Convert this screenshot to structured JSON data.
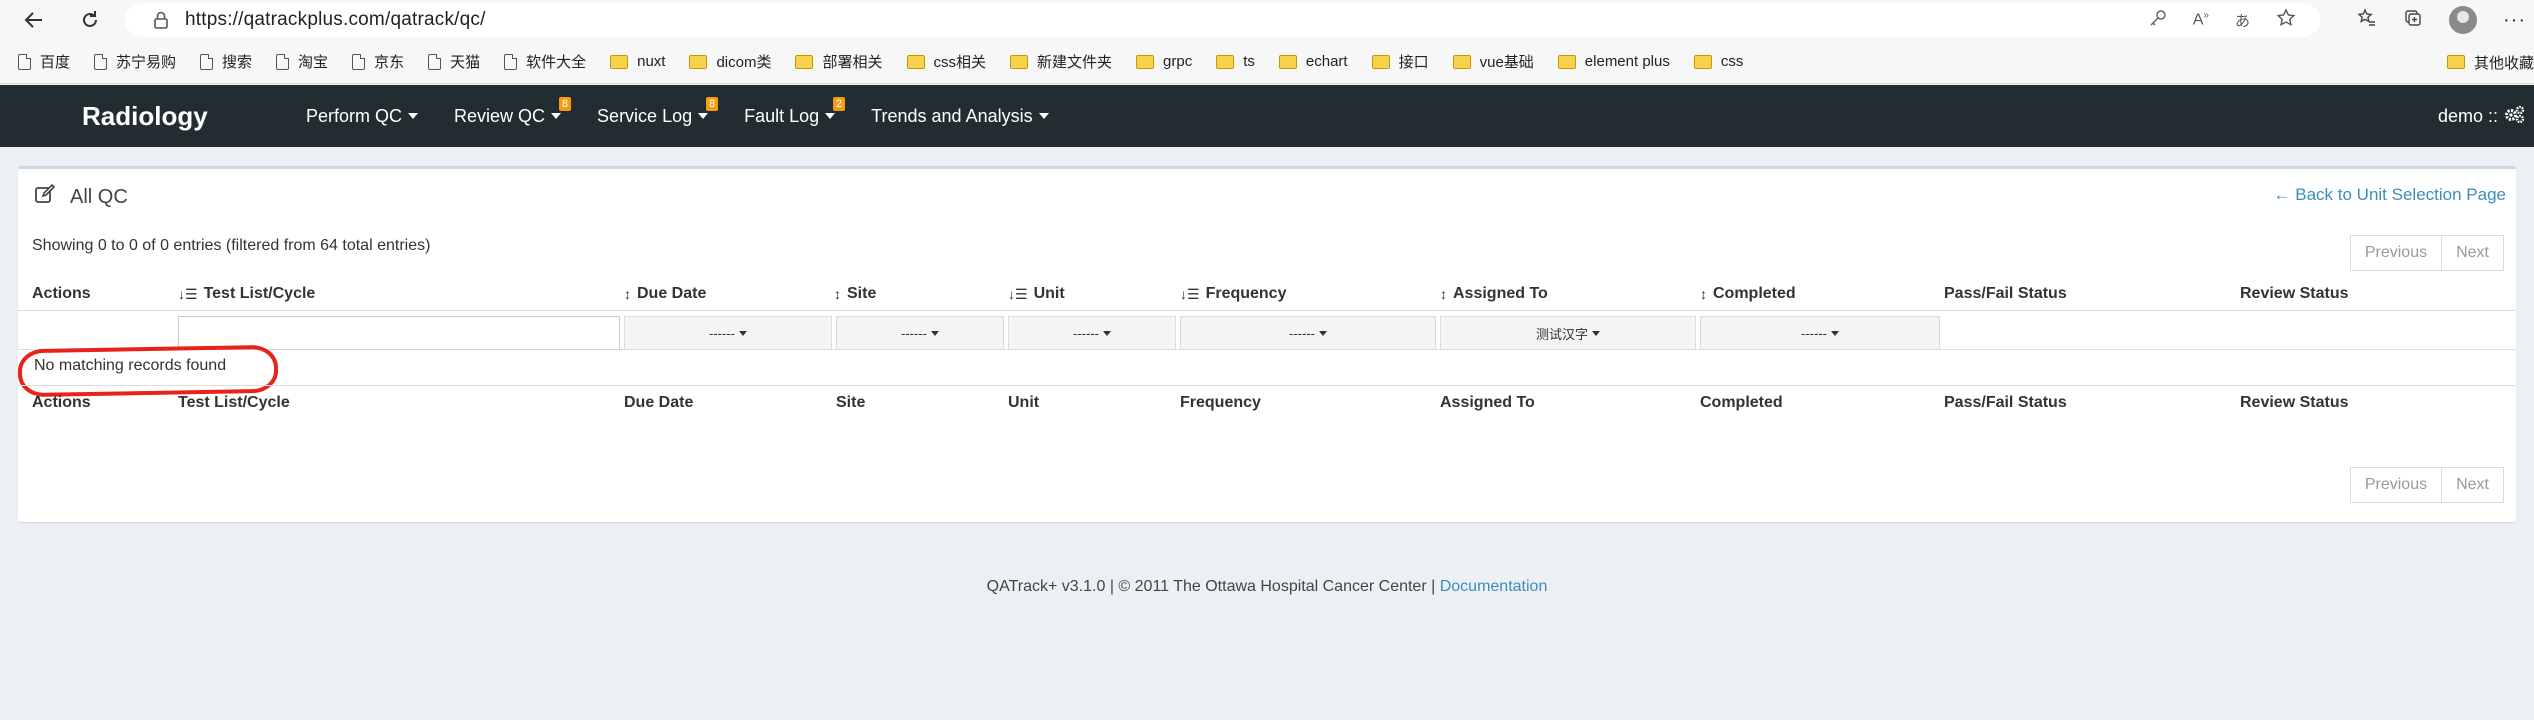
{
  "browser": {
    "url": "https://qatrackplus.com/qatrack/qc/"
  },
  "bookmarks": {
    "items": [
      {
        "label": "百度",
        "icon": "doc"
      },
      {
        "label": "苏宁易购",
        "icon": "doc"
      },
      {
        "label": "搜索",
        "icon": "doc"
      },
      {
        "label": "淘宝",
        "icon": "doc"
      },
      {
        "label": "京东",
        "icon": "doc"
      },
      {
        "label": "天猫",
        "icon": "doc"
      },
      {
        "label": "软件大全",
        "icon": "doc"
      },
      {
        "label": "nuxt",
        "icon": "folder"
      },
      {
        "label": "dicom类",
        "icon": "folder"
      },
      {
        "label": "部署相关",
        "icon": "folder"
      },
      {
        "label": "css相关",
        "icon": "folder"
      },
      {
        "label": "新建文件夹",
        "icon": "folder"
      },
      {
        "label": "grpc",
        "icon": "folder"
      },
      {
        "label": "ts",
        "icon": "folder"
      },
      {
        "label": "echart",
        "icon": "folder"
      },
      {
        "label": "接口",
        "icon": "folder"
      },
      {
        "label": "vue基础",
        "icon": "folder"
      },
      {
        "label": "element plus",
        "icon": "folder"
      },
      {
        "label": "css",
        "icon": "folder"
      }
    ],
    "other": "其他收藏"
  },
  "navbar": {
    "brand": "Radiology",
    "items": [
      {
        "label": "Perform QC",
        "badge": ""
      },
      {
        "label": "Review QC",
        "badge": "8"
      },
      {
        "label": "Service Log",
        "badge": "8"
      },
      {
        "label": "Fault Log",
        "badge": "2"
      },
      {
        "label": "Trends and Analysis",
        "badge": ""
      }
    ],
    "user": "demo ::"
  },
  "page": {
    "title": "All QC",
    "back_link": "← Back to Unit Selection Page",
    "info": "Showing 0 to 0 of 0 entries (filtered from 64 total entries)",
    "pager": {
      "previous": "Previous",
      "next": "Next"
    },
    "columns": [
      "Actions",
      "Test List/Cycle",
      "Due Date",
      "Site",
      "Unit",
      "Frequency",
      "Assigned To",
      "Completed",
      "Pass/Fail Status",
      "Review Status"
    ],
    "filters": {
      "test_list": "",
      "due_date": "------",
      "site": "------",
      "unit": "------",
      "frequency": "------",
      "assigned_to": "测试汉字",
      "completed": "------"
    },
    "empty_message": "No matching records found"
  },
  "footer": {
    "text": "QATrack+ v3.1.0 | © 2011 The Ottawa Hospital Cancer Center |",
    "link": "Documentation"
  },
  "colors": {
    "navbar": "#222d32",
    "badge": "#f39c12",
    "link": "#3c8dbc",
    "highlight": "#e8231b",
    "background": "#ecf0f5"
  }
}
